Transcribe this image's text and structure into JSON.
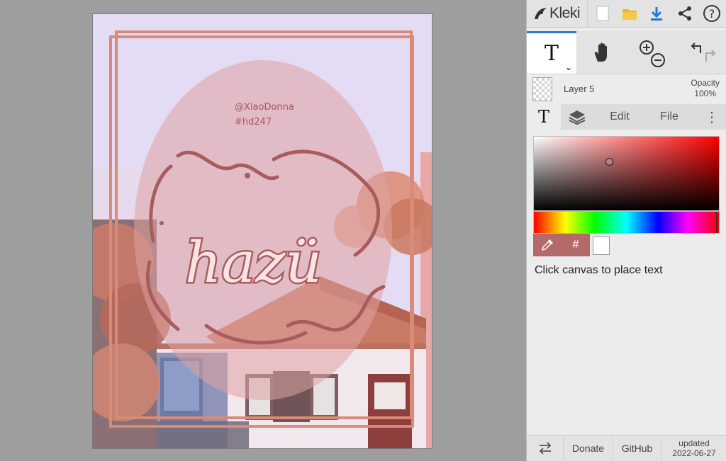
{
  "app": {
    "name": "Kleki"
  },
  "canvas": {
    "artwork_handle": "@XiaoDonna",
    "artwork_tag": "#hd247",
    "artwork_title": "hazü"
  },
  "topbar": {
    "icons": [
      "new-image-icon",
      "open-folder-icon",
      "download-icon",
      "share-icon",
      "help-icon"
    ],
    "help_label": "?"
  },
  "tools": {
    "text_tool_label": "T",
    "items": [
      "text-tool",
      "hand-tool",
      "zoom-in",
      "zoom-out",
      "undo",
      "redo"
    ]
  },
  "layer": {
    "name": "Layer 5",
    "opacity_label": "Opacity",
    "opacity_value": "100%"
  },
  "tabs": {
    "text_icon_label": "T",
    "edit": "Edit",
    "file": "File",
    "more": "⋮"
  },
  "color": {
    "hex_button_label": "#",
    "secondary_color": "#ffffff",
    "primary_color": "#b46a6a"
  },
  "hint": "Click canvas to place text",
  "footer": {
    "donate": "Donate",
    "github": "GitHub",
    "updated_label": "updated",
    "updated_date": "2022-06-27"
  }
}
